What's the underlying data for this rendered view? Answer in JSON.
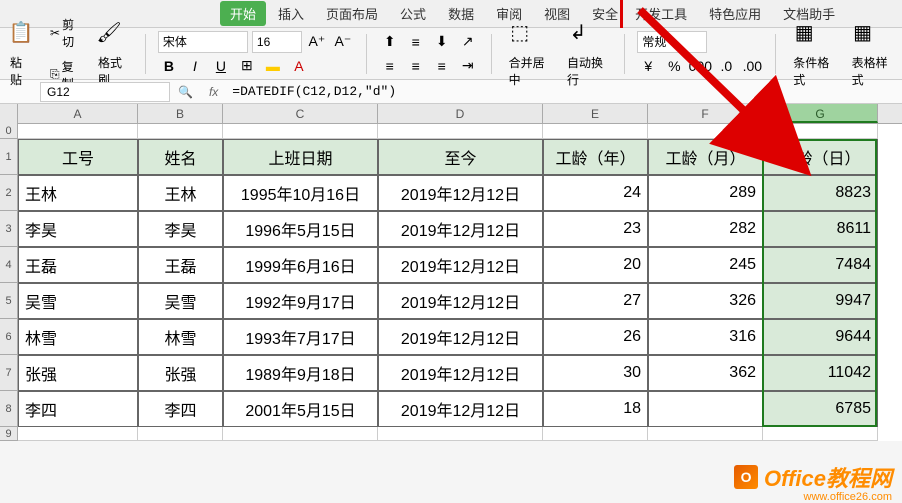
{
  "ribbon": {
    "tabs": [
      "开始",
      "插入",
      "页面布局",
      "公式",
      "数据",
      "审阅",
      "视图",
      "安全",
      "开发工具",
      "特色应用",
      "文档助手"
    ],
    "active_index": 0
  },
  "toolbar": {
    "paste": "粘贴",
    "cut": "剪切",
    "copy": "复制",
    "format_painter": "格式刷",
    "font_name": "宋体",
    "font_size": "16",
    "merge": "合并居中",
    "wrap": "自动换行",
    "general": "常规",
    "cond_format": "条件格式",
    "table_style": "表格样式"
  },
  "formula_bar": {
    "name_box": "G12",
    "formula": "=DATEDIF(C12,D12,\"d\")"
  },
  "columns": [
    "A",
    "B",
    "C",
    "D",
    "E",
    "F",
    "G"
  ],
  "row_numbers": [
    "0",
    "1",
    "2",
    "3",
    "4",
    "5",
    "6",
    "7",
    "8",
    "9"
  ],
  "table_headers": [
    "工号",
    "姓名",
    "上班日期",
    "至今",
    "工龄（年）",
    "工龄（月）",
    "工龄（日）"
  ],
  "chart_data": {
    "type": "table",
    "columns": [
      "工号",
      "姓名",
      "上班日期",
      "至今",
      "工龄（年）",
      "工龄（月）",
      "工龄（日）"
    ],
    "rows": [
      {
        "id": "王林",
        "name": "王林",
        "start": "1995年10月16日",
        "end": "2019年12月12日",
        "years": 24,
        "months": 289,
        "days": 8823
      },
      {
        "id": "李昊",
        "name": "李昊",
        "start": "1996年5月15日",
        "end": "2019年12月12日",
        "years": 23,
        "months": 282,
        "days": 8611
      },
      {
        "id": "王磊",
        "name": "王磊",
        "start": "1999年6月16日",
        "end": "2019年12月12日",
        "years": 20,
        "months": 245,
        "days": 7484
      },
      {
        "id": "吴雪",
        "name": "吴雪",
        "start": "1992年9月17日",
        "end": "2019年12月12日",
        "years": 27,
        "months": 326,
        "days": 9947
      },
      {
        "id": "林雪",
        "name": "林雪",
        "start": "1993年7月17日",
        "end": "2019年12月12日",
        "years": 26,
        "months": 316,
        "days": 9644
      },
      {
        "id": "张强",
        "name": "张强",
        "start": "1989年9月18日",
        "end": "2019年12月12日",
        "years": 30,
        "months": 362,
        "days": 11042
      },
      {
        "id": "李四",
        "name": "李四",
        "start": "2001年5月15日",
        "end": "2019年12月12日",
        "years": 18,
        "months": "",
        "days": 6785
      }
    ]
  },
  "watermark": {
    "text": "Office教程网",
    "url": "www.office26.com"
  }
}
